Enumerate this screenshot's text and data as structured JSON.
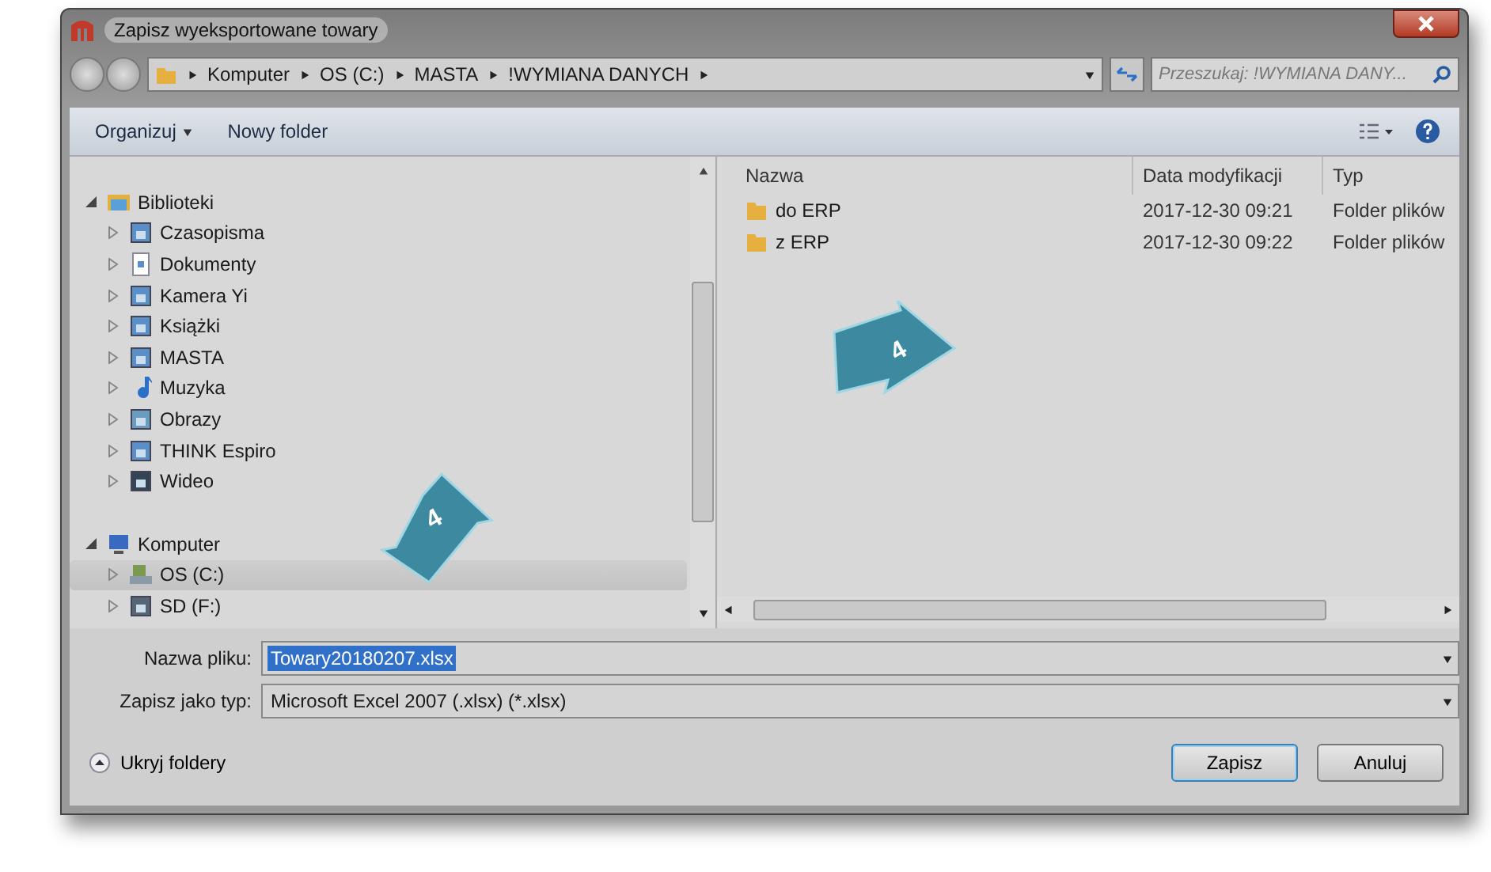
{
  "window": {
    "title": "Zapisz wyeksportowane towary"
  },
  "address": {
    "crumbs": [
      "Komputer",
      "OS (C:)",
      "MASTA",
      "!WYMIANA DANYCH"
    ]
  },
  "search": {
    "placeholder": "Przeszukaj: !WYMIANA DANY..."
  },
  "toolbar": {
    "organize": "Organizuj",
    "new_folder": "Nowy folder"
  },
  "tree": [
    {
      "label": "Biblioteki",
      "kind": "libraries",
      "expanded": true,
      "selected": false,
      "children": [
        {
          "label": "Czasopisma",
          "kind": "library",
          "expanded": false,
          "selected": false
        },
        {
          "label": "Dokumenty",
          "kind": "document",
          "expanded": false,
          "selected": false
        },
        {
          "label": "Kamera Yi",
          "kind": "library",
          "expanded": false,
          "selected": false
        },
        {
          "label": "Książki",
          "kind": "library",
          "expanded": false,
          "selected": false
        },
        {
          "label": "MASTA",
          "kind": "library",
          "expanded": false,
          "selected": false
        },
        {
          "label": "Muzyka",
          "kind": "music",
          "expanded": false,
          "selected": false
        },
        {
          "label": "Obrazy",
          "kind": "pictures",
          "expanded": false,
          "selected": false
        },
        {
          "label": "THINK Espiro",
          "kind": "library",
          "expanded": false,
          "selected": false
        },
        {
          "label": "Wideo",
          "kind": "video",
          "expanded": false,
          "selected": false
        }
      ]
    },
    {
      "label": "Komputer",
      "kind": "computer",
      "expanded": true,
      "selected": false,
      "children": [
        {
          "label": "OS (C:)",
          "kind": "drive",
          "expanded": false,
          "selected": true
        },
        {
          "label": "SD (F:)",
          "kind": "sd",
          "expanded": false,
          "selected": false
        }
      ]
    }
  ],
  "table": {
    "columns": [
      "Nazwa",
      "Data modyfikacji",
      "Typ"
    ],
    "rows": [
      {
        "name": "do ERP",
        "date": "2017-12-30 09:21",
        "type": "Folder plików"
      },
      {
        "name": "z ERP",
        "date": "2017-12-30 09:22",
        "type": "Folder plików"
      }
    ]
  },
  "fields": [
    {
      "label": "Nazwa pliku:",
      "value": "Towary20180207.xlsx",
      "selected": true
    },
    {
      "label": "Zapisz jako typ:",
      "value": "Microsoft Excel 2007 (.xlsx) (*.xlsx)",
      "selected": false
    }
  ],
  "hide_folders": "Ukryj foldery",
  "buttons": [
    {
      "label": "Zapisz",
      "selected": true
    },
    {
      "label": "Anuluj",
      "selected": false
    }
  ],
  "callouts": [
    "4",
    "4"
  ]
}
